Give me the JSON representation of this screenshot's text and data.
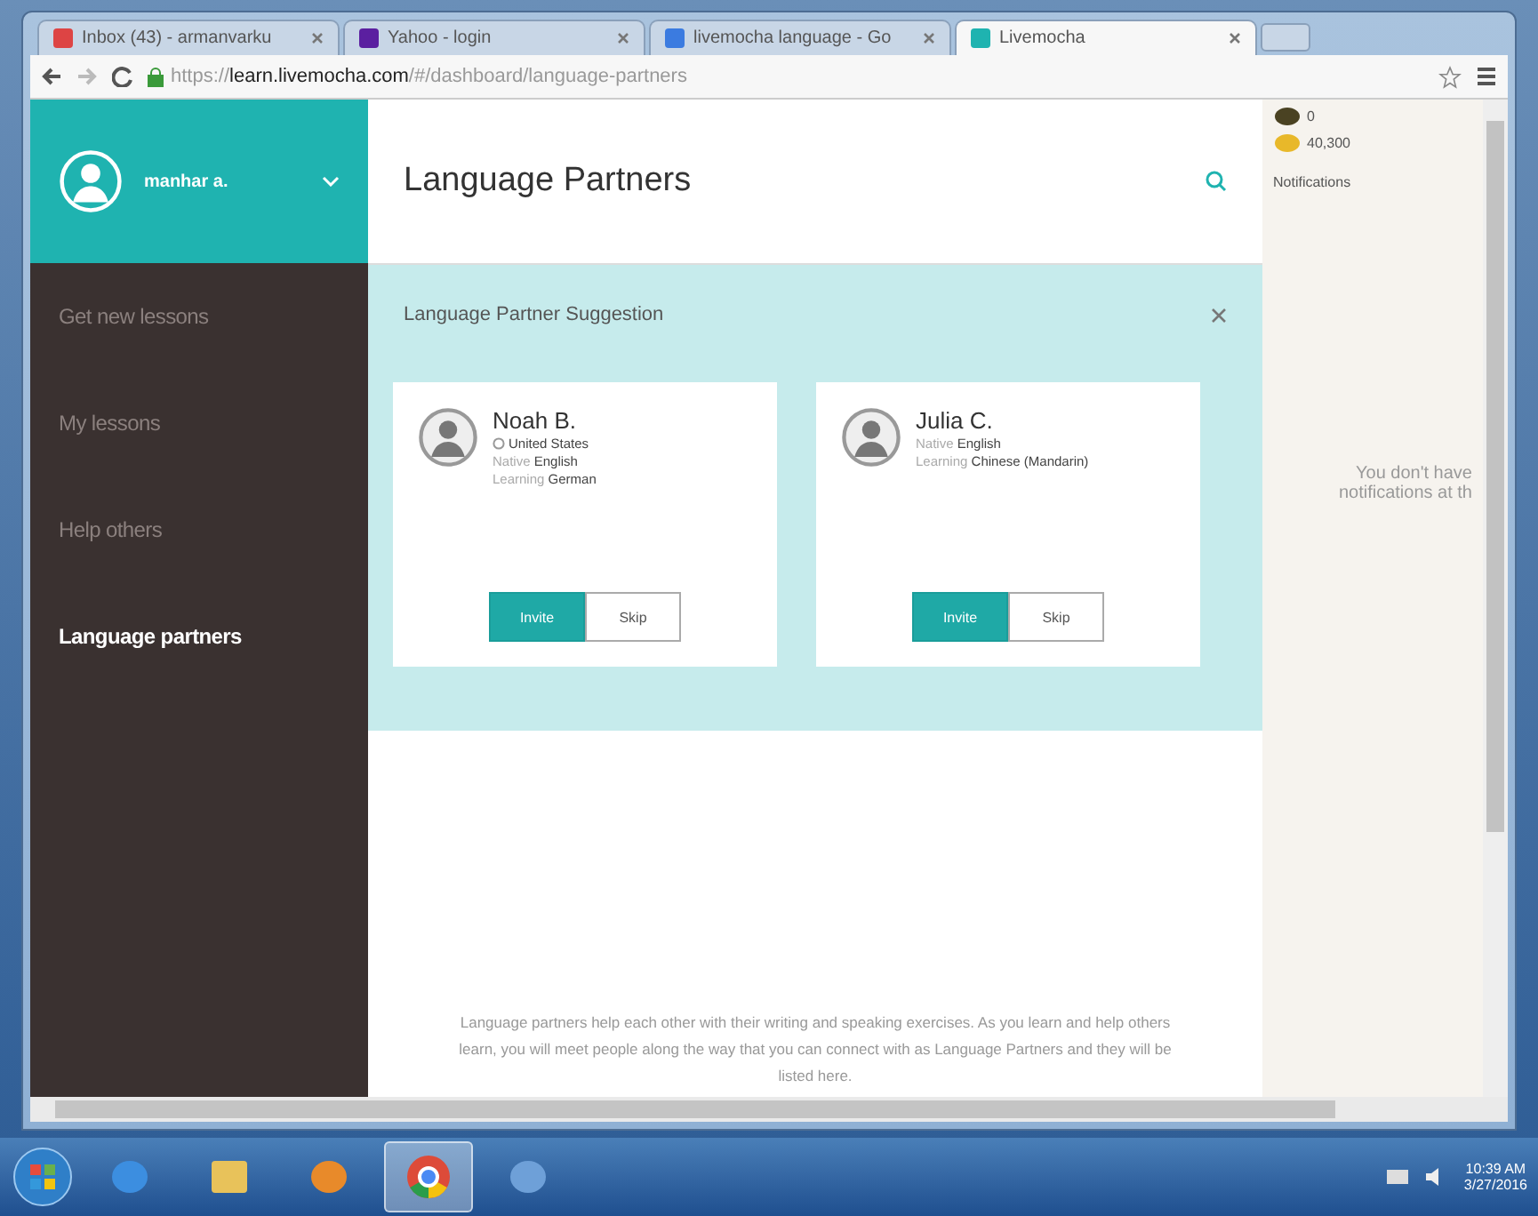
{
  "browser": {
    "tabs": [
      {
        "kind": "mail",
        "title": "Inbox (43) - armanvarku",
        "selected": false
      },
      {
        "kind": "yahoo",
        "title": "Yahoo - login",
        "selected": false
      },
      {
        "kind": "search",
        "title": "livemocha language - Go",
        "selected": false
      },
      {
        "kind": "site",
        "title": "Livemocha",
        "selected": true
      }
    ],
    "address": "https://**learn.livemocha.com**/#/dashboard/language-partners"
  },
  "sidebar": {
    "user": "manhar a.",
    "items": [
      {
        "label": "Get new lessons",
        "selected": false
      },
      {
        "label": "My lessons",
        "selected": false
      },
      {
        "label": "Help others",
        "selected": false
      },
      {
        "label": "Language partners",
        "selected": true
      }
    ]
  },
  "main": {
    "title": "Language Partners",
    "suggestion": {
      "title": "Language Partner Suggestion",
      "partners": [
        {
          "name": "Noah B.",
          "country": "United States",
          "fields": [
            {
              "label": "Native",
              "value": "English"
            },
            {
              "label": "Learning",
              "value": "German"
            }
          ],
          "buttons": [
            {
              "kind": "primary",
              "label": "Invite"
            },
            {
              "kind": "secondary",
              "label": "Skip"
            }
          ]
        },
        {
          "name": "Julia C.",
          "fields": [
            {
              "label": "Native",
              "value": "English"
            },
            {
              "label": "Learning",
              "value": "Chinese (Mandarin)"
            }
          ],
          "buttons": [
            {
              "kind": "primary",
              "label": "Invite"
            },
            {
              "kind": "secondary",
              "label": "Skip"
            }
          ]
        }
      ]
    },
    "footer_text": "Language partners help each other with their writing and speaking exercises. As you learn and help others learn, you will meet people along the way that you can connect with as Language Partners and they will be listed here."
  },
  "wallet": [
    {
      "kind": "dark",
      "amount": "0"
    },
    {
      "kind": "gold",
      "amount": "40,300"
    }
  ],
  "notifications": {
    "title": "Notifications",
    "empty_lines": [
      "You don't have",
      "notifications at th"
    ]
  },
  "taskbar": {
    "apps": [
      {
        "kind": "ie",
        "selected": false
      },
      {
        "kind": "folder",
        "selected": false
      },
      {
        "kind": "media",
        "selected": false
      },
      {
        "kind": "chrome",
        "selected": true
      },
      {
        "kind": "doc",
        "selected": false
      }
    ],
    "time": "10:39 AM",
    "date": "3/27/2016"
  }
}
